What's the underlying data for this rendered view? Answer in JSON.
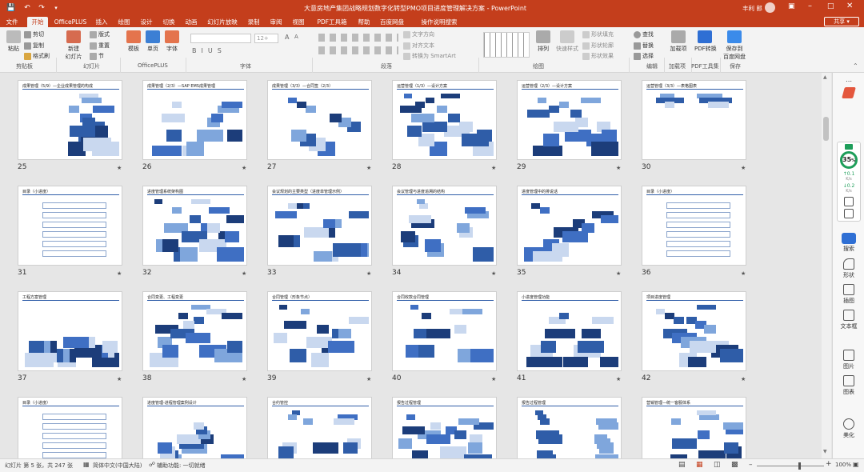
{
  "window": {
    "title": "大意房地产集团战略规划数字化转型PMO项目进度管理解决方案 - PowerPoint",
    "user": "丰利 郎"
  },
  "tabs": [
    "文件",
    "开始",
    "OfficePLUS",
    "插入",
    "绘图",
    "设计",
    "切换",
    "动画",
    "幻灯片放映",
    "录制",
    "审阅",
    "视图",
    "PDF工具箱",
    "帮助",
    "百度网盘",
    "操作说明搜索"
  ],
  "active_tab": "开始",
  "share_label": "共享",
  "ribbon": {
    "clipboard": {
      "paste": "粘贴",
      "cut": "剪切",
      "copy": "复制",
      "format_painter": "格式刷",
      "group": "剪贴板"
    },
    "slides": {
      "new": "新建",
      "new2": "幻灯片",
      "layout": "版式",
      "reset": "重置",
      "section": "节",
      "group": "幻灯片"
    },
    "officeplus": {
      "template": "模板",
      "single": "单页",
      "font": "字体",
      "group": "OfficePLUS"
    },
    "font": {
      "group": "字体",
      "size_placeholder": "12+"
    },
    "paragraph": {
      "group": "段落",
      "text_dir": "文字方向",
      "align_text": "对齐文本",
      "smartart": "转换为 SmartArt"
    },
    "drawing": {
      "group": "绘图",
      "arrange": "排列",
      "quick_styles": "快速样式",
      "fill": "形状填充",
      "outline": "形状轮廓",
      "effects": "形状效果"
    },
    "editing": {
      "find": "查找",
      "replace": "替换",
      "select": "选择",
      "group": "编辑"
    },
    "addins": {
      "addins": "加载项",
      "group": "加载项"
    },
    "pdf": {
      "convert": "PDF转换",
      "group": "PDF工具集"
    },
    "save": {
      "save_baidu": "保存到",
      "save_baidu2": "百度网盘",
      "group": "保存"
    }
  },
  "slides": [
    {
      "n": 25,
      "title": "成果管理（5/9）—企业成果管理的构成"
    },
    {
      "n": 26,
      "title": "成果管理（2/3）—SAP EMS成果管理"
    },
    {
      "n": 27,
      "title": "成果管理（3/3）—合同签（2/3）"
    },
    {
      "n": 28,
      "title": "运营管理（1/3）—设计方案"
    },
    {
      "n": 29,
      "title": "运营管理（2/3）—设计方案"
    },
    {
      "n": 30,
      "title": "运营管理（3/3）—表格图表"
    },
    {
      "n": 31,
      "title": "目录（小进度）"
    },
    {
      "n": 32,
      "title": "进度管理系统架构图"
    },
    {
      "n": 33,
      "title": "会议规划的主要类型（进度单管理示例）"
    },
    {
      "n": 34,
      "title": "会议管理与进度追溯的结构"
    },
    {
      "n": 35,
      "title": "进度管理中的排说话"
    },
    {
      "n": 36,
      "title": "目录（小进度）"
    },
    {
      "n": 37,
      "title": "工程方案管理"
    },
    {
      "n": 38,
      "title": "合同变更、工程变更"
    },
    {
      "n": 39,
      "title": "合同管理（形象节点）"
    },
    {
      "n": 40,
      "title": "合同收款合同管理"
    },
    {
      "n": 41,
      "title": "小进度管理功能"
    },
    {
      "n": 42,
      "title": "项目进度管理"
    },
    {
      "n": 43,
      "title": "目录（小进度）"
    },
    {
      "n": 44,
      "title": "进度管理-进程管理案例设计"
    },
    {
      "n": 45,
      "title": "合约管控"
    },
    {
      "n": 46,
      "title": "报告过程管理"
    },
    {
      "n": 47,
      "title": "报告过程管理"
    },
    {
      "n": 48,
      "title": "营销管理—统一客服体系"
    }
  ],
  "right_panel": {
    "gauge": "35",
    "gauge_unit": "%",
    "up": "0.1",
    "up_unit": "K/s",
    "down": "0.2",
    "down_unit": "K/s",
    "items": [
      "搜索",
      "形状",
      "插图",
      "文本框",
      "图片",
      "图表",
      "美化"
    ]
  },
  "status": {
    "slide_info": "幻灯片 第 5 张，共 247 张",
    "lang": "简体中文(中国大陆)",
    "accessibility": "辅助功能: 一切就绪",
    "zoom": "100%"
  },
  "colors": {
    "accent": "#c43e1c",
    "selection": "#c43e1c",
    "gauge": "#1e9e5a"
  }
}
